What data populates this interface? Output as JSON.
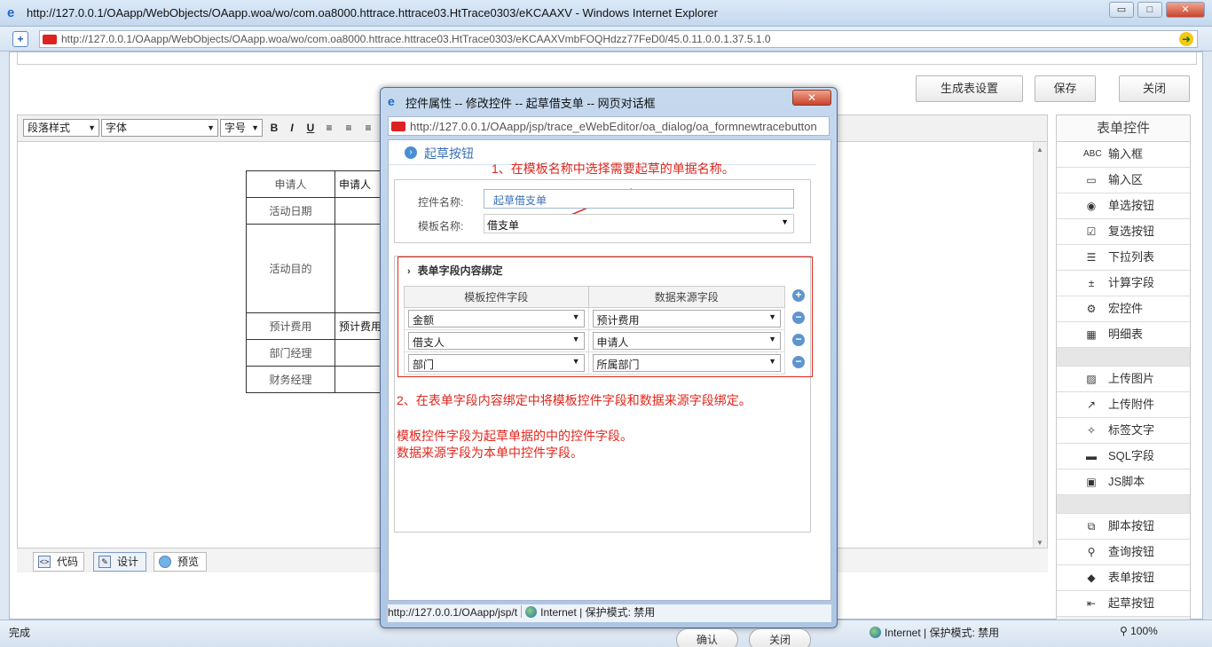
{
  "ie": {
    "title": "http://127.0.0.1/OAapp/WebObjects/OAapp.woa/wo/com.oa8000.httrace.httrace03.HtTrace0303/eKCAAXV - Windows Internet Explorer",
    "address": "http://127.0.0.1/OAapp/WebObjects/OAapp.woa/wo/com.oa8000.httrace.httrace03.HtTrace0303/eKCAAXVmbFOQHdzz77FeD0/45.0.11.0.0.1.37.5.1.0",
    "min": "▭",
    "max": "□",
    "close": "✕"
  },
  "top_buttons": {
    "gen": "生成表设置",
    "save": "保存",
    "close": "关闭"
  },
  "toolbar": {
    "para": "段落样式",
    "font": "字体",
    "size": "字号"
  },
  "form_rows": [
    {
      "label": "申请人",
      "value": "申请人"
    },
    {
      "label": "活动日期",
      "value": ""
    },
    {
      "label": "活动目的",
      "value": ""
    },
    {
      "label": "预计费用",
      "value": "预计费用"
    },
    {
      "label": "部门经理",
      "value": ""
    },
    {
      "label": "财务经理",
      "value": ""
    }
  ],
  "editor_tabs": {
    "code": "代码",
    "design": "设计",
    "preview": "预览"
  },
  "panel": {
    "title": "表单控件",
    "group1": [
      "输入框",
      "输入区",
      "单选按钮",
      "复选按钮",
      "下拉列表",
      "计算字段",
      "宏控件",
      "明细表"
    ],
    "group2": [
      "上传图片",
      "上传附件",
      "标签文字",
      "SQL字段",
      "JS脚本"
    ],
    "group3": [
      "脚本按钮",
      "查询按钮",
      "表单按钮",
      "起草按钮"
    ],
    "icons": {
      "g1_0": "ABC"
    }
  },
  "statusbar": {
    "done": "完成",
    "zone": "Internet | 保护模式: 禁用",
    "zoom": "100%"
  },
  "dialog": {
    "title": "控件属性 -- 修改控件 -- 起草借支单 -- 网页对话框",
    "address": "http://127.0.0.1/OAapp/jsp/trace_eWebEditor/oa_dialog/oa_formnewtracebutton",
    "section": "起草按钮",
    "annot1": "1、在模板名称中选择需要起草的单据名称。",
    "name_label": "控件名称:",
    "name_value": "起草借支单",
    "template_label": "模板名称:",
    "template_value": "借支单",
    "bind_title": "表单字段内容绑定",
    "col1": "模板控件字段",
    "col2": "数据来源字段",
    "rows": [
      {
        "a": "金额",
        "b": "预计费用"
      },
      {
        "a": "借支人",
        "b": "申请人"
      },
      {
        "a": "部门",
        "b": "所属部门"
      }
    ],
    "annot2": "2、在表单字段内容绑定中将模板控件字段和数据来源字段绑定。",
    "annot3": "模板控件字段为起草单据的中的控件字段。",
    "annot4": "数据来源字段为本单中控件字段。",
    "ok": "确认",
    "cancel": "关闭",
    "status_url": "http://127.0.0.1/OAapp/jsp/t",
    "status_zone": "Internet | 保护模式: 禁用"
  }
}
